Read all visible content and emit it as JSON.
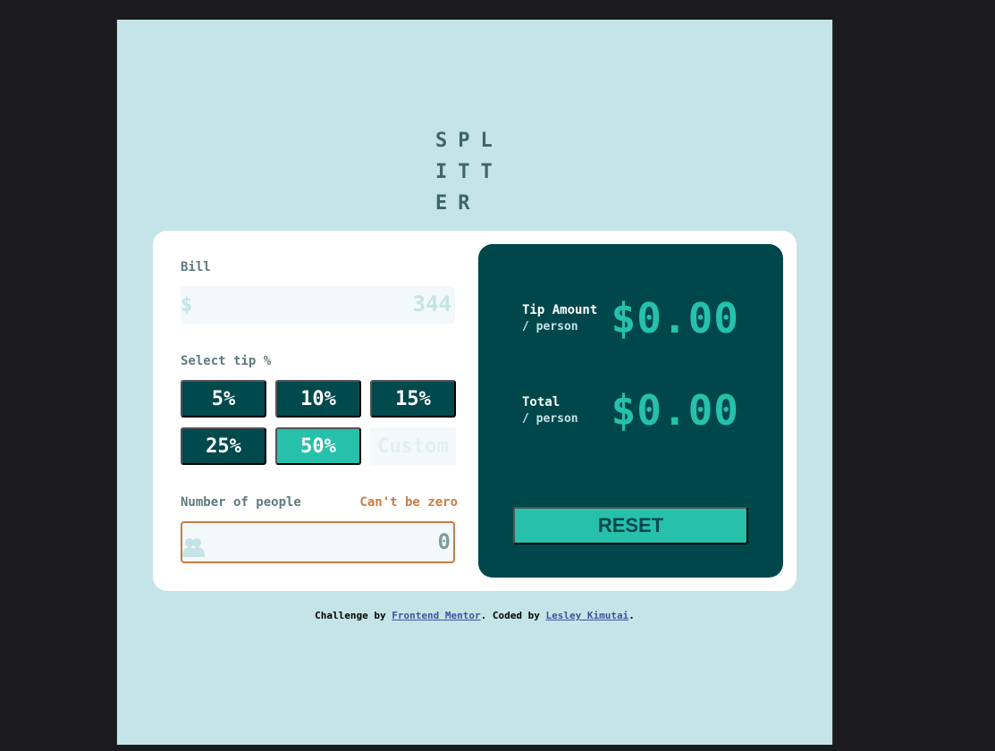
{
  "app": {
    "logo": "SPLITTER"
  },
  "form": {
    "bill_label": "Bill",
    "bill_prefix": "$",
    "bill_value": "344",
    "tip_label": "Select tip %",
    "tips": [
      {
        "label": "5%",
        "active": false
      },
      {
        "label": "10%",
        "active": false
      },
      {
        "label": "15%",
        "active": false
      },
      {
        "label": "25%",
        "active": false
      },
      {
        "label": "50%",
        "active": true
      }
    ],
    "custom_placeholder": "Custom",
    "people_label": "Number of people",
    "people_error": "Can't be zero",
    "people_value": "0"
  },
  "results": {
    "tip_label": "Tip Amount",
    "tip_sub": "/ person",
    "tip_value": "$0.00",
    "total_label": "Total",
    "total_sub": "/ person",
    "total_value": "$0.00",
    "reset_label": "RESET"
  },
  "footer": {
    "prefix": "Challenge by ",
    "link1": "Frontend Mentor",
    "middle": ". Coded by ",
    "link2": "Lesley Kimutai",
    "suffix": "."
  },
  "colors": {
    "accent": "#26c0ab",
    "dark_teal": "#00474b",
    "error": "#c97d45",
    "background": "#c5e4e7"
  }
}
